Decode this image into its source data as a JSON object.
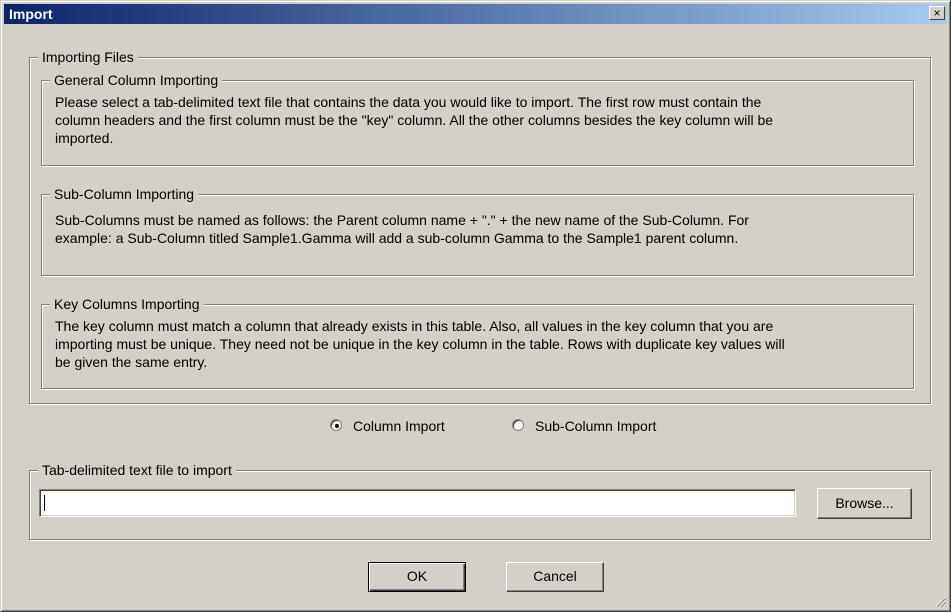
{
  "window": {
    "title": "Import",
    "close_glyph": "×"
  },
  "importing_files": {
    "legend": "Importing Files",
    "general": {
      "legend": "General Column Importing",
      "lines": [
        "Please select a tab-delimited text file that contains the data you would like to import.  The first row must contain the",
        "column headers and the first column must be the \"key\" column. All the other columns besides the key column will be",
        "imported."
      ]
    },
    "sub_column": {
      "legend": "Sub-Column Importing",
      "lines": [
        "Sub-Columns must be named as follows: the Parent column name + \".\" + the new name of the Sub-Column. For",
        "example: a Sub-Column titled Sample1.Gamma will add a sub-column Gamma to the Sample1 parent column."
      ]
    },
    "key_columns": {
      "legend": "Key Columns Importing",
      "lines": [
        "The key column must match a column that already exists in this table.  Also, all values in the key column that you are",
        "importing must be unique.  They need not be unique in the key column in the table.  Rows with duplicate key values will",
        "be given the same entry."
      ]
    }
  },
  "import_mode": {
    "options": [
      {
        "label": "Column Import",
        "selected": true
      },
      {
        "label": "Sub-Column Import",
        "selected": false
      }
    ]
  },
  "file_section": {
    "legend": "Tab-delimited text file to import",
    "file_path_value": "",
    "browse_label": "Browse..."
  },
  "actions": {
    "ok_label": "OK",
    "cancel_label": "Cancel"
  },
  "colors": {
    "face": "#d4d0c8",
    "titlebar_start": "#0a246a",
    "titlebar_end": "#a6caf0"
  }
}
